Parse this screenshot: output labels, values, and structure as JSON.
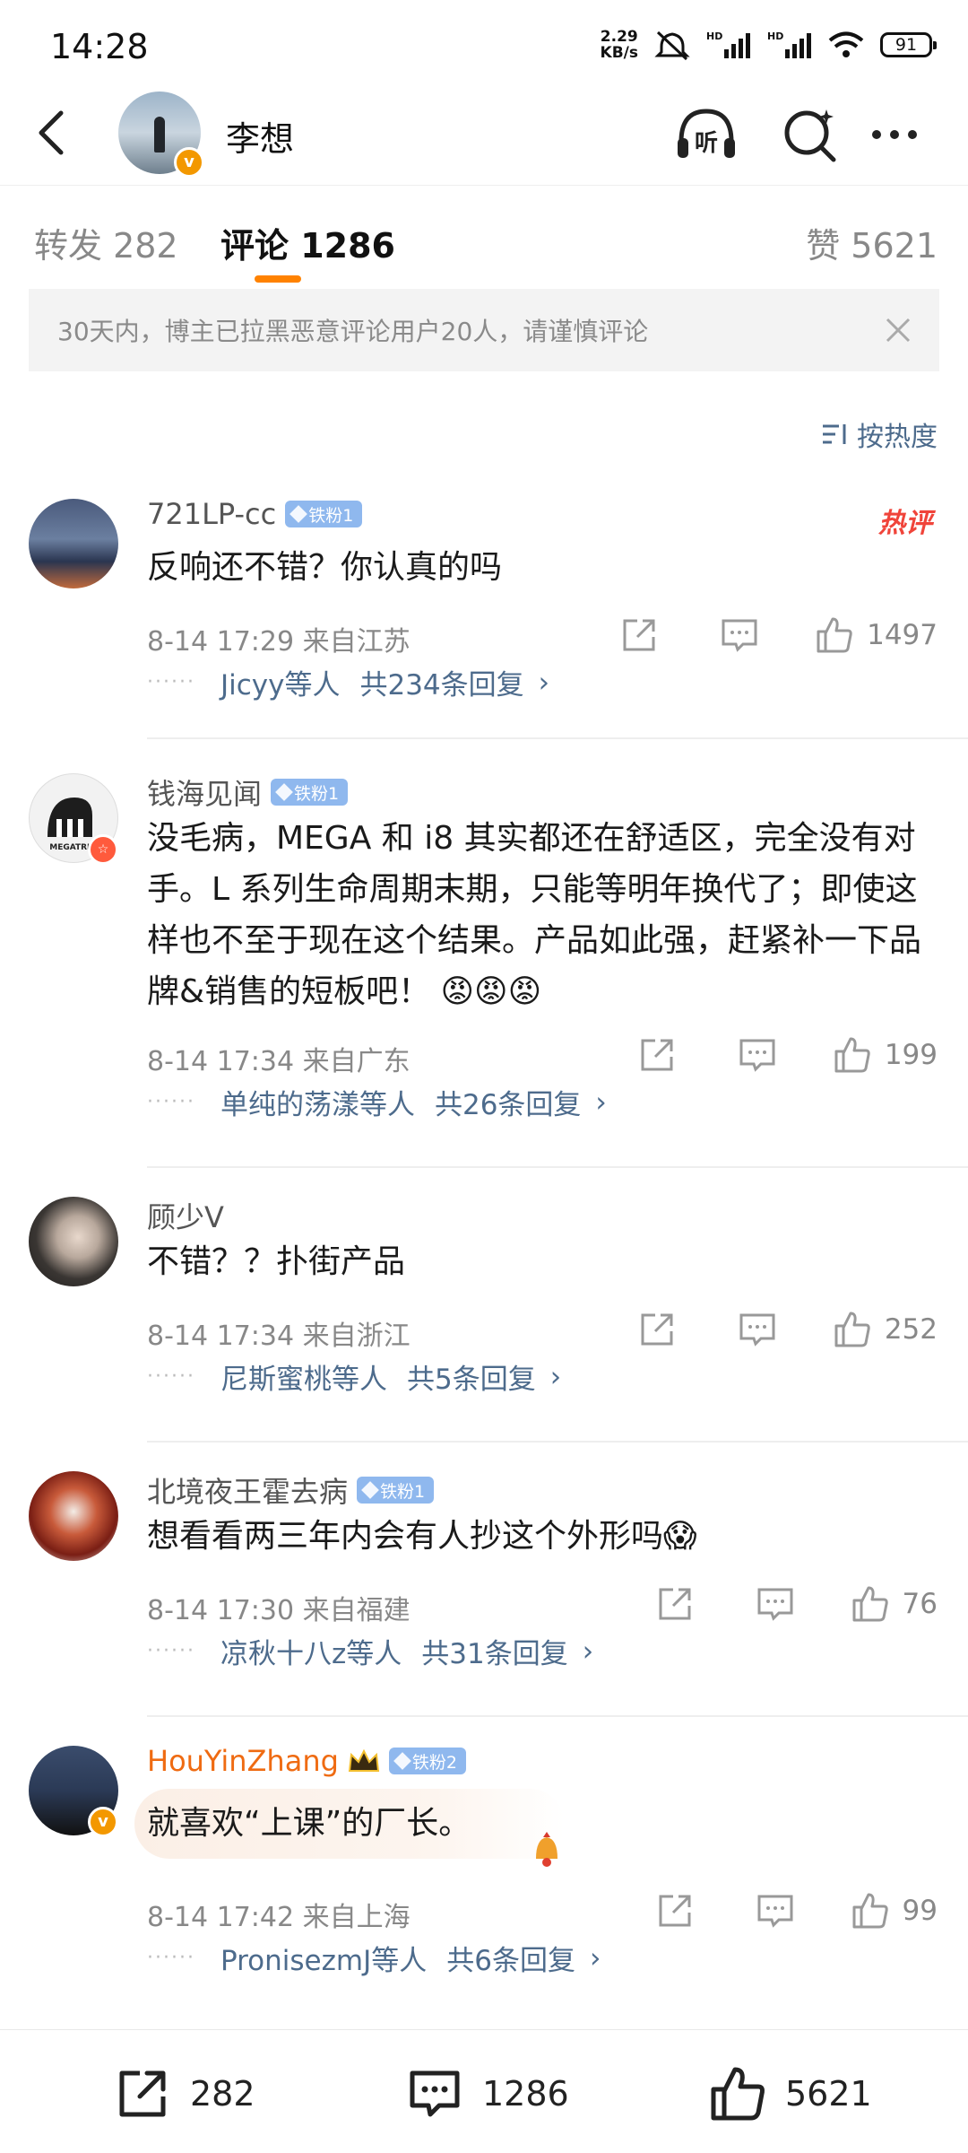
{
  "status_bar": {
    "time": "14:28",
    "net_speed_value": "2.29",
    "net_speed_unit": "KB/s",
    "battery": "91",
    "hd_label": "HD"
  },
  "header": {
    "user_name": "李想",
    "verified_badge": "v",
    "icons": [
      "back-icon",
      "listen-icon",
      "search-icon",
      "more-icon"
    ],
    "listen_label": "听"
  },
  "tabs": [
    {
      "label": "转发 282"
    },
    {
      "label": "评论 1286"
    },
    {
      "label": "赞 5621"
    }
  ],
  "notice": {
    "text": "30天内，博主已拉黑恶意评论用户20人，请谨慎评论"
  },
  "sort": {
    "label": "按热度"
  },
  "hot_tag": "热评",
  "comments": [
    {
      "name": "721LP-cc",
      "badge": "铁粉1",
      "text": "反响还不错？你认真的吗",
      "time": "8-14 17:29",
      "location": "来自江苏",
      "likes": "1497",
      "reply_users": "Jicyy等人",
      "reply_count": "共234条回复"
    },
    {
      "name": "钱海见闻",
      "badge": "铁粉1",
      "text": "没毛病，MEGA 和 i8 其实都还在舒适区，完全没有对手。L 系列生命周期末期，只能等明年换代了；即使这样也不至于现在这个结果。产品如此强，赶紧补一下品牌&销售的短板吧！",
      "emoji": "😡😡😡",
      "avatar_text": "MEGATREN",
      "time": "8-14 17:34",
      "location": "来自广东",
      "likes": "199",
      "reply_users": "单纯的荡漾等人",
      "reply_count": "共26条回复"
    },
    {
      "name": "顾少V",
      "text": "不错？？扑街产品",
      "time": "8-14 17:34",
      "location": "来自浙江",
      "likes": "252",
      "reply_users": "尼斯蜜桃等人",
      "reply_count": "共5条回复"
    },
    {
      "name": "北境夜王霍去病",
      "badge": "铁粉1",
      "text": "想看看两三年内会有人抄这个外形吗",
      "emoji": "😱",
      "time": "8-14 17:30",
      "location": "来自福建",
      "likes": "76",
      "reply_users": "凉秋十八z等人",
      "reply_count": "共31条回复"
    },
    {
      "name": "HouYinZhang",
      "badge": "铁粉2",
      "text": "就喜欢“上课”的厂长。",
      "time": "8-14 17:42",
      "location": "来自上海",
      "likes": "99",
      "reply_users": "PronisezmJ等人",
      "reply_count": "共6条回复"
    }
  ],
  "bottom_bar": {
    "repost_count": "282",
    "comment_count": "1286",
    "like_count": "5621"
  },
  "colors": {
    "accent": "#ff8200",
    "link": "#4d6b8c",
    "hot": "#f0443a",
    "vip_name": "#ef6b12",
    "fan_badge": "#8fb8ee"
  }
}
